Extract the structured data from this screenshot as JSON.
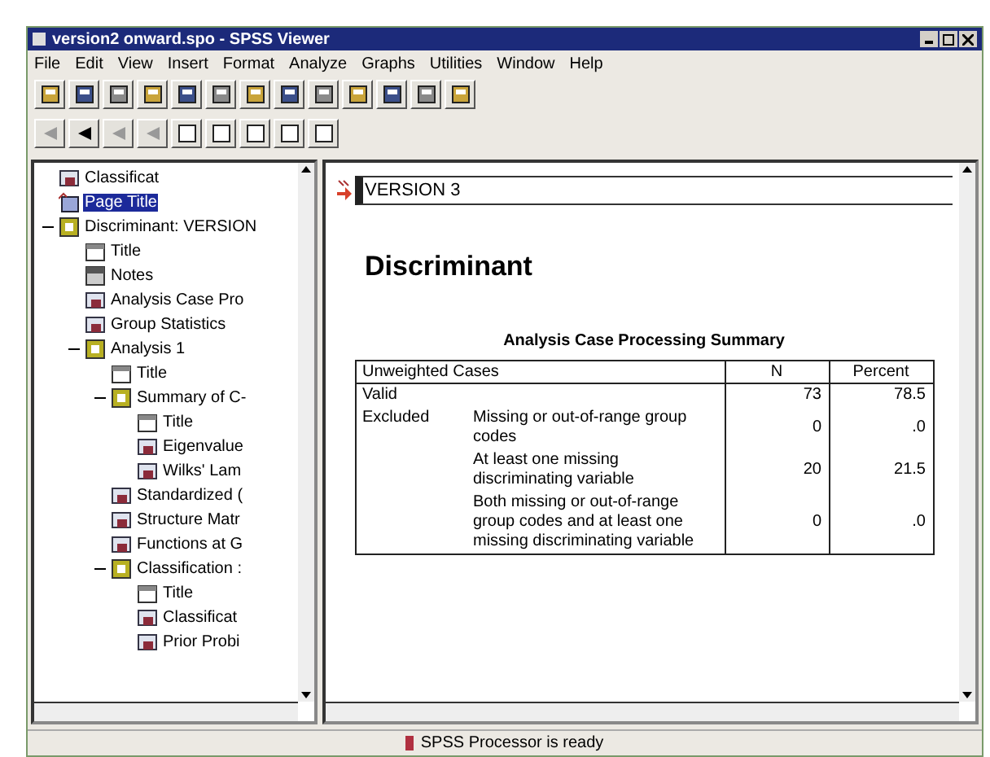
{
  "window": {
    "title": "version2 onward.spo - SPSS Viewer"
  },
  "menu": [
    "File",
    "Edit",
    "View",
    "Insert",
    "Format",
    "Analyze",
    "Graphs",
    "Utilities",
    "Window",
    "Help"
  ],
  "outline": [
    {
      "label": "Classificat",
      "kind": "table",
      "selected": false
    },
    {
      "label": "Page Title",
      "kind": "page",
      "selected": true
    },
    {
      "label": "Discriminant: VERSION",
      "kind": "book",
      "selected": false,
      "expanded": true,
      "children": [
        {
          "label": "Title",
          "kind": "title",
          "selected": false
        },
        {
          "label": "Notes",
          "kind": "notes",
          "selected": false
        },
        {
          "label": "Analysis Case Pro",
          "kind": "table",
          "selected": false
        },
        {
          "label": "Group Statistics",
          "kind": "table",
          "selected": false
        },
        {
          "label": "Analysis 1",
          "kind": "book",
          "selected": false,
          "expanded": true,
          "children": [
            {
              "label": "Title",
              "kind": "title",
              "selected": false
            },
            {
              "label": "Summary of C-",
              "kind": "book",
              "selected": false,
              "expanded": true,
              "children": [
                {
                  "label": "Title",
                  "kind": "title",
                  "selected": false
                },
                {
                  "label": "Eigenvalue",
                  "kind": "table",
                  "selected": false
                },
                {
                  "label": "Wilks' Lam",
                  "kind": "table",
                  "selected": false
                }
              ]
            },
            {
              "label": "Standardized (",
              "kind": "table",
              "selected": false
            },
            {
              "label": "Structure Matr",
              "kind": "table",
              "selected": false
            },
            {
              "label": "Functions at G",
              "kind": "table",
              "selected": false
            },
            {
              "label": "Classification :",
              "kind": "book",
              "selected": false,
              "expanded": true,
              "children": [
                {
                  "label": "Title",
                  "kind": "title",
                  "selected": false
                },
                {
                  "label": "Classificat",
                  "kind": "table",
                  "selected": false
                },
                {
                  "label": "Prior Probi",
                  "kind": "table",
                  "selected": false
                }
              ]
            }
          ]
        }
      ]
    }
  ],
  "output": {
    "title_text": "VERSION 3",
    "heading": "Discriminant",
    "table_title": "Analysis Case Processing Summary",
    "columns": [
      "Unweighted Cases",
      "N",
      "Percent"
    ],
    "rows": [
      {
        "label": "Valid",
        "subrows": [
          {
            "label": "",
            "n": "73",
            "percent": "78.5"
          }
        ]
      },
      {
        "label": "Excluded",
        "subrows": [
          {
            "label": "Missing or out-of-range group codes",
            "n": "0",
            "percent": ".0"
          },
          {
            "label": "At least one missing discriminating variable",
            "n": "20",
            "percent": "21.5"
          },
          {
            "label": "Both missing or out-of-range group codes and at least one missing discriminating variable",
            "n": "0",
            "percent": ".0"
          }
        ]
      }
    ]
  },
  "status_bar": "SPSS Processor  is ready"
}
